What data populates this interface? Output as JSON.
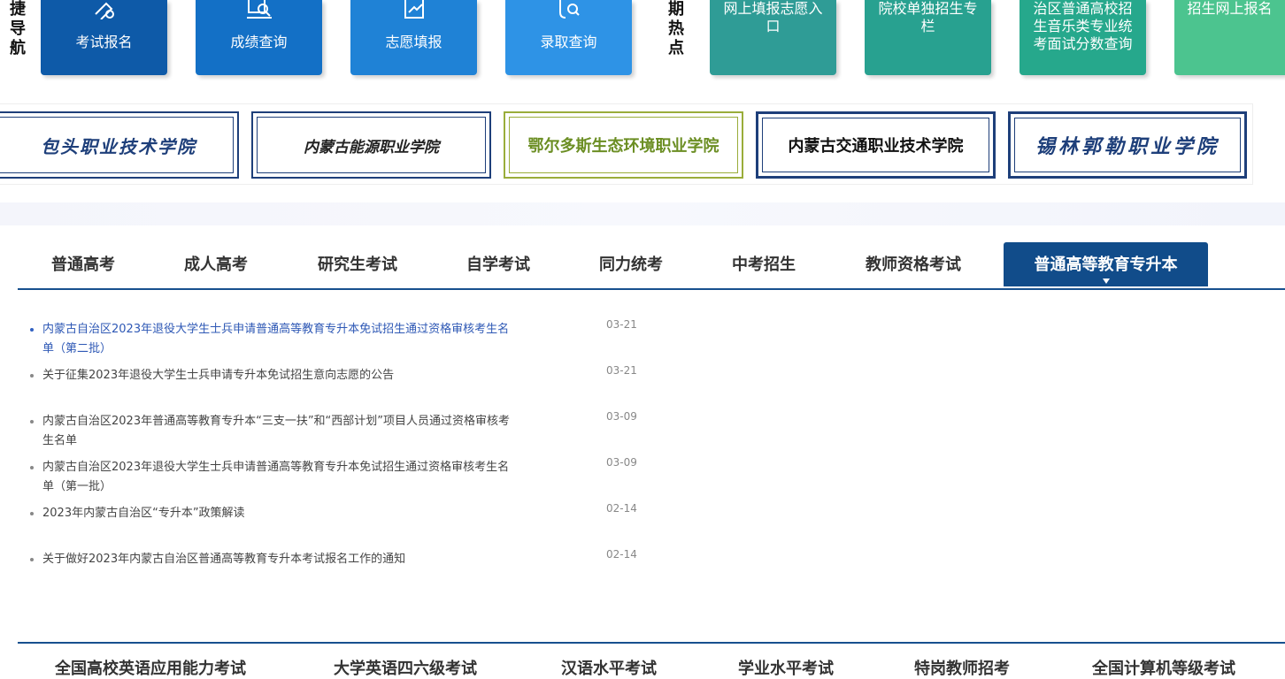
{
  "quick_nav": {
    "label": [
      "捷",
      "导",
      "航"
    ],
    "items": [
      {
        "label": "考试报名",
        "icon": "pen-icon",
        "color": "#0e5aa8"
      },
      {
        "label": "成绩查询",
        "icon": "search-doc-icon",
        "color": "#1370c6"
      },
      {
        "label": "志愿填报",
        "icon": "edit-form-icon",
        "color": "#1f82d6"
      },
      {
        "label": "录取查询",
        "icon": "admission-icon",
        "color": "#2e93e6"
      }
    ]
  },
  "hot": {
    "label": [
      "期",
      "热",
      "点"
    ],
    "items": [
      {
        "label": "网上填报志愿入口",
        "color": "#2f9c96"
      },
      {
        "label": "院校单独招生专栏",
        "color": "#28a190"
      },
      {
        "label": "治区普通高校招生音乐类专业统考面试分数查询",
        "color": "#26a88c"
      },
      {
        "label": "招生网上报名",
        "color": "#4cc48f"
      }
    ]
  },
  "schools": [
    {
      "name": "包头职业技术学院",
      "color": "#1e3f7a",
      "bg": "#ffffff"
    },
    {
      "name": "内蒙古能源职业学院",
      "color": "#222222",
      "bg": "#ffffff"
    },
    {
      "name": "鄂尔多斯生态环境职业学院",
      "color": "#6b8e23",
      "bg": "#ffffff"
    },
    {
      "name": "内蒙古交通职业技术学院",
      "color": "#111111",
      "bg": "#ffffff"
    },
    {
      "name": "锡林郭勒职业学院",
      "color": "#1e3f7a",
      "bg": "#ffffff"
    }
  ],
  "tabs": [
    {
      "label": "普通高考"
    },
    {
      "label": "成人高考"
    },
    {
      "label": "研究生考试"
    },
    {
      "label": "自学考试"
    },
    {
      "label": "同力统考"
    },
    {
      "label": "中考招生"
    },
    {
      "label": "教师资格考试"
    },
    {
      "label": "普通高等教育专升本"
    }
  ],
  "active_tab": 7,
  "news": [
    {
      "title": "内蒙古自治区2023年退役大学生士兵申请普通高等教育专升本免试招生通过资格审核考生名单（第二批）",
      "date": "03-21"
    },
    {
      "title": "关于征集2023年退役大学生士兵申请专升本免试招生意向志愿的公告",
      "date": "03-21"
    },
    {
      "title": "内蒙古自治区2023年普通高等教育专升本“三支一扶”和“西部计划”项目人员通过资格审核考生名单",
      "date": "03-09"
    },
    {
      "title": "内蒙古自治区2023年退役大学生士兵申请普通高等教育专升本免试招生通过资格审核考生名单（第一批）",
      "date": "03-09"
    },
    {
      "title": "2023年内蒙古自治区“专升本”政策解读",
      "date": "02-14"
    },
    {
      "title": "关于做好2023年内蒙古自治区普通高等教育专升本考试报名工作的通知",
      "date": "02-14"
    }
  ],
  "bottom_tabs": [
    {
      "label": "全国高校英语应用能力考试"
    },
    {
      "label": "大学英语四六级考试"
    },
    {
      "label": "汉语水平考试"
    },
    {
      "label": "学业水平考试"
    },
    {
      "label": "特岗教师招考"
    },
    {
      "label": "全国计算机等级考试"
    }
  ]
}
